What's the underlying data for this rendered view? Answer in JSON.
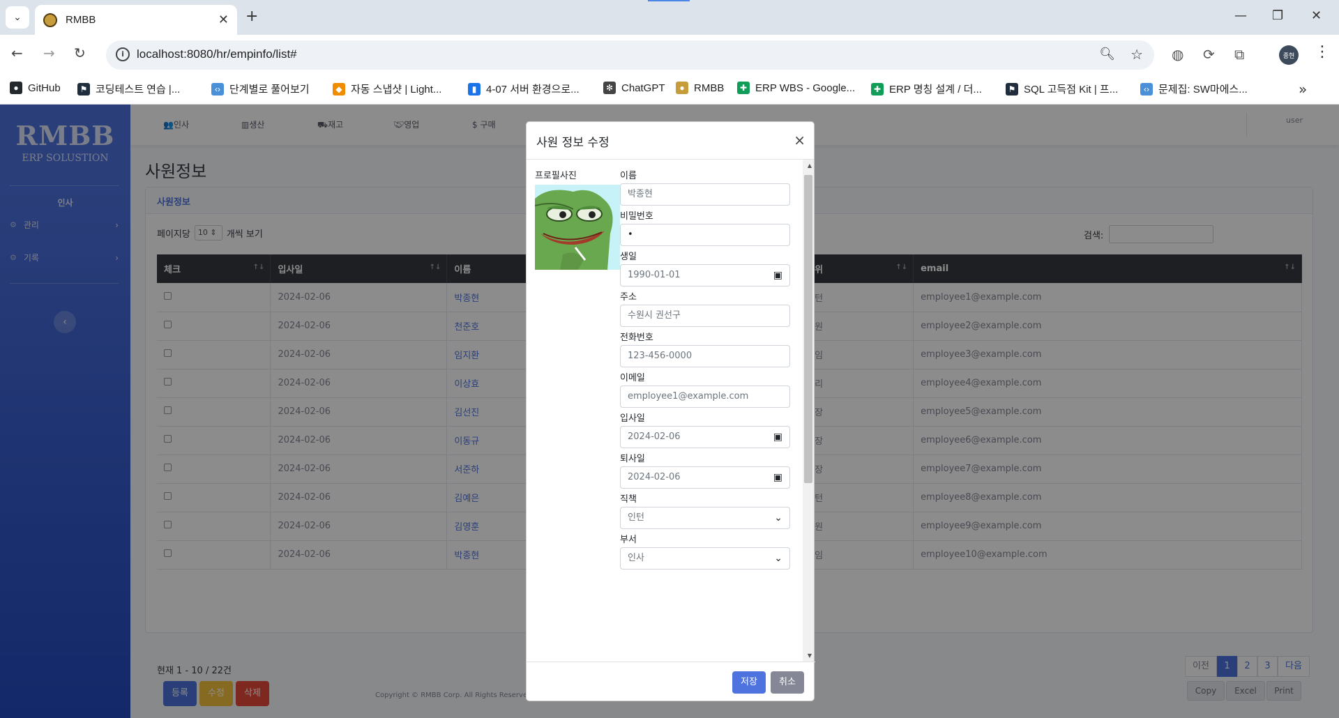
{
  "browser": {
    "tab_title": "RMBB",
    "url": "localhost:8080/hr/empinfo/list#",
    "profile_label": "종현",
    "bookmarks": [
      {
        "label": "GitHub",
        "icon": "github-icon",
        "color": "#24292e"
      },
      {
        "label": "코딩테스트 연습 |...",
        "icon": "flag-icon",
        "color": "#1f2d3d"
      },
      {
        "label": "단계별로 풀어보기",
        "icon": "code-icon",
        "color": "#4a90d9"
      },
      {
        "label": "자동 스냅샷 | Light...",
        "icon": "cube-icon",
        "color": "#f08c00"
      },
      {
        "label": "4-07 서버 환경으로...",
        "icon": "book-icon",
        "color": "#1a73e8"
      },
      {
        "label": "ChatGPT",
        "icon": "chatgpt-icon",
        "color": "#444444"
      },
      {
        "label": "RMBB",
        "icon": "rmbb-icon",
        "color": "#c79d3b"
      },
      {
        "label": "ERP WBS - Google...",
        "icon": "sheets-icon",
        "color": "#0f9d58"
      },
      {
        "label": "ERP 명칭 설계 / 더...",
        "icon": "sheets-icon",
        "color": "#0f9d58"
      },
      {
        "label": "SQL 고득점 Kit | 프...",
        "icon": "flag-icon",
        "color": "#1f2d3d"
      },
      {
        "label": "문제집: SW마에스...",
        "icon": "code-icon",
        "color": "#4a90d9"
      }
    ]
  },
  "sidebar": {
    "brand": "RMBB",
    "brand_sub": "ERP SOLUSTION",
    "heading": "인사",
    "items": [
      {
        "label": "관리"
      },
      {
        "label": "기록"
      }
    ]
  },
  "topnav": {
    "items": [
      "인사",
      "생산",
      "재고",
      "영업",
      "구매"
    ],
    "user": "user"
  },
  "page": {
    "title": "사원정보",
    "card_title": "사원정보",
    "length_prefix": "페이지당",
    "length_value": "10",
    "length_suffix": "개씩 보기",
    "search_label": "검색:",
    "columns": [
      "체크",
      "입사일",
      "이름",
      "직위",
      "email"
    ],
    "rows": [
      {
        "date": "2024-02-06",
        "name": "박종현",
        "rank": "인턴",
        "email": "employee1@example.com"
      },
      {
        "date": "2024-02-06",
        "name": "천준호",
        "rank": "사원",
        "email": "employee2@example.com"
      },
      {
        "date": "2024-02-06",
        "name": "임지환",
        "rank": "주임",
        "email": "employee3@example.com"
      },
      {
        "date": "2024-02-06",
        "name": "이상효",
        "rank": "대리",
        "email": "employee4@example.com"
      },
      {
        "date": "2024-02-06",
        "name": "김선진",
        "rank": "과장",
        "email": "employee5@example.com"
      },
      {
        "date": "2024-02-06",
        "name": "이동규",
        "rank": "차장",
        "email": "employee6@example.com"
      },
      {
        "date": "2024-02-06",
        "name": "서준하",
        "rank": "부장",
        "email": "employee7@example.com"
      },
      {
        "date": "2024-02-06",
        "name": "김예은",
        "rank": "인턴",
        "email": "employee8@example.com"
      },
      {
        "date": "2024-02-06",
        "name": "김영훈",
        "rank": "사원",
        "email": "employee9@example.com"
      },
      {
        "date": "2024-02-06",
        "name": "박종현",
        "rank": "주임",
        "email": "employee10@example.com"
      }
    ],
    "info": "현재 1 - 10 / 22건",
    "buttons": {
      "add": "등록",
      "edit": "수정",
      "delete": "삭제"
    },
    "pagination": {
      "prev": "이전",
      "pages": [
        "1",
        "2",
        "3"
      ],
      "next": "다음"
    },
    "export": [
      "Copy",
      "Excel",
      "Print"
    ],
    "copyright": "Copyright © RMBB Corp. All Rights Reserved"
  },
  "modal": {
    "title": "사원 정보 수정",
    "close": "×",
    "photo_label": "프로필사진",
    "fields": {
      "name": {
        "label": "이름",
        "placeholder": "박종현"
      },
      "password": {
        "label": "비밀번호",
        "value": "•"
      },
      "birth": {
        "label": "생일",
        "value": "1990-01-01"
      },
      "address": {
        "label": "주소",
        "placeholder": "수원시 권선구"
      },
      "phone": {
        "label": "전화번호",
        "placeholder": "123-456-0000"
      },
      "email": {
        "label": "이메일",
        "placeholder": "employee1@example.com"
      },
      "hire_date": {
        "label": "입사일",
        "value": "2024-02-06"
      },
      "leave_date": {
        "label": "퇴사일",
        "value": "2024-02-06"
      },
      "position": {
        "label": "직책",
        "value": "인턴"
      },
      "department": {
        "label": "부서",
        "value": "인사"
      }
    },
    "save": "저장",
    "cancel": "취소"
  },
  "colors": {
    "primary": "#4e73df",
    "warning": "#f6c23e",
    "danger": "#e74a3b",
    "secondary": "#858796"
  }
}
